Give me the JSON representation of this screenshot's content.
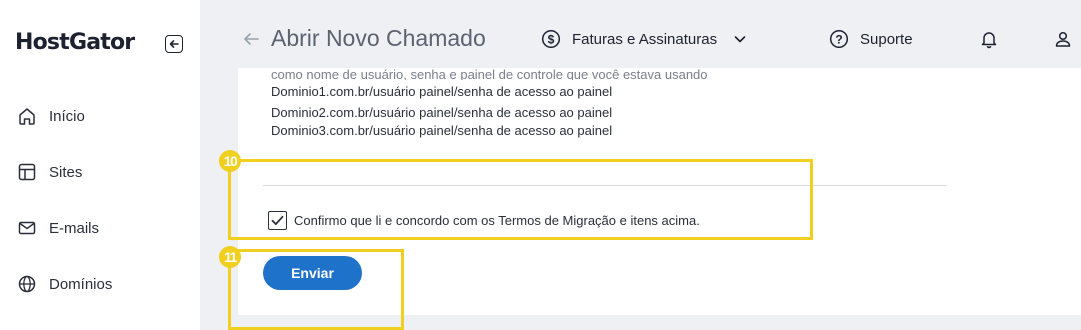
{
  "sidebar": {
    "logo": "HostGator",
    "items": [
      {
        "label": "Início",
        "icon": "home-icon"
      },
      {
        "label": "Sites",
        "icon": "layout-icon"
      },
      {
        "label": "E-mails",
        "icon": "mail-icon"
      },
      {
        "label": "Domínios",
        "icon": "globe-icon"
      }
    ]
  },
  "header": {
    "title": "Abrir Novo Chamado",
    "billing_label": "Faturas e Assinaturas",
    "support_label": "Suporte"
  },
  "form": {
    "cut_text": "como nome de usuário, senha e painel de controle que você estava usando",
    "example_lines": [
      "Dominio1.com.br/usuário painel/senha de acesso ao painel",
      "Dominio2.com.br/usuário painel/senha de acesso ao painel",
      "Dominio3.com.br/usuário painel/senha de acesso ao painel"
    ],
    "confirm_label": "Confirmo que li e concordo com os Termos de Migração e itens acima.",
    "confirm_checked": true,
    "submit_label": "Enviar"
  },
  "annotations": [
    {
      "number": "10",
      "target": "confirm-checkbox"
    },
    {
      "number": "11",
      "target": "submit-button"
    }
  ],
  "colors": {
    "accent": "#1f72c9",
    "highlight": "#f0cf1e",
    "background": "#eef0f4"
  }
}
